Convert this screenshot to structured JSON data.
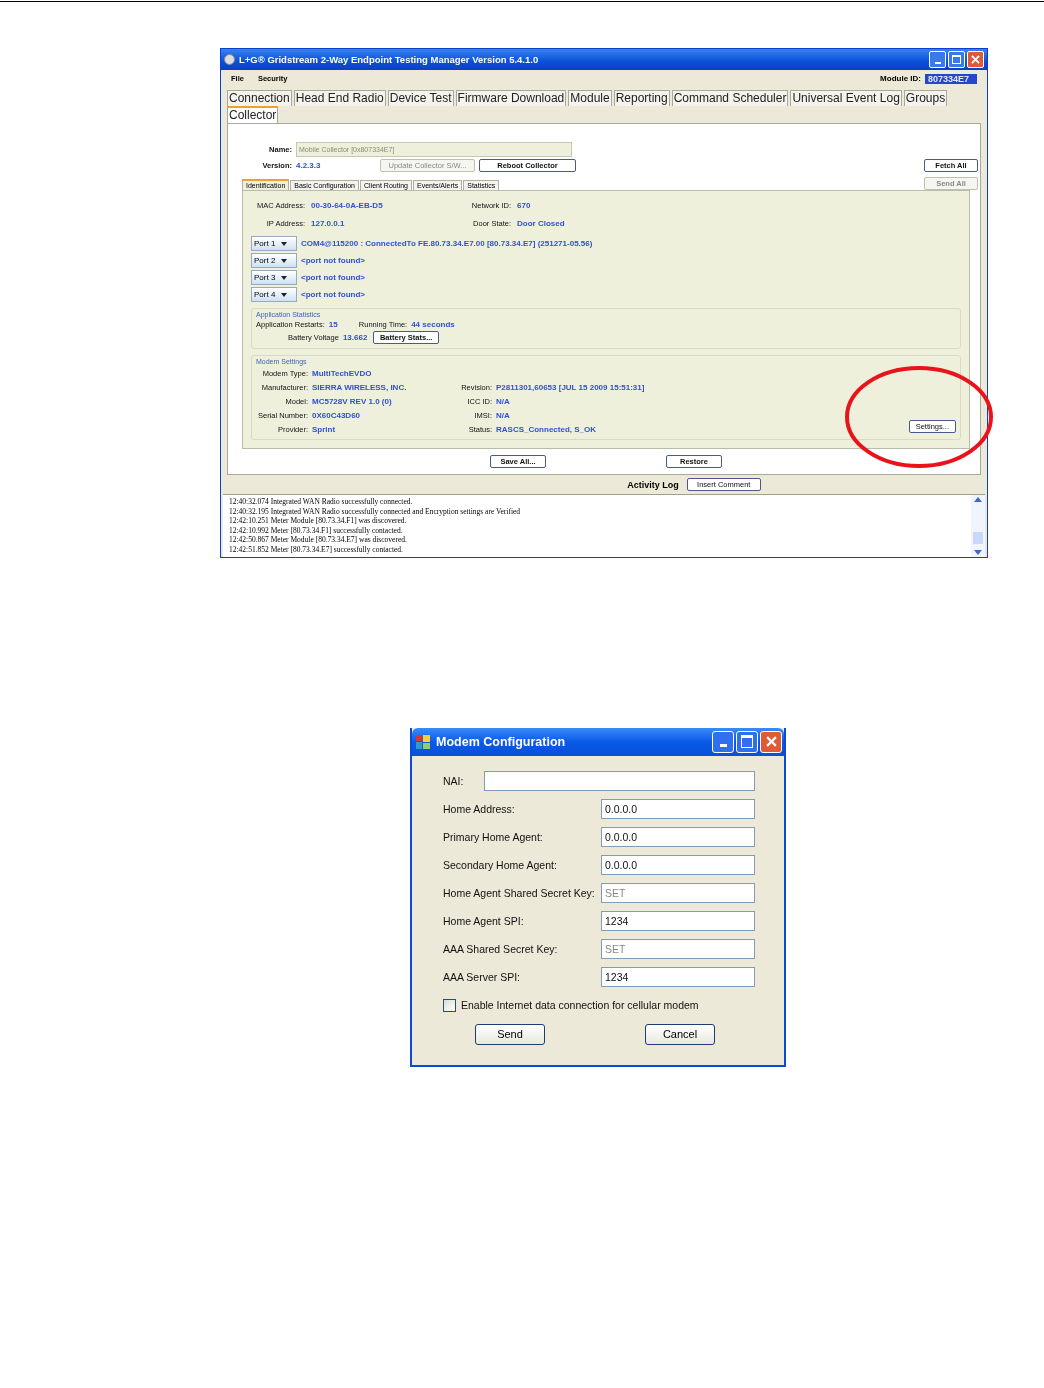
{
  "main_window": {
    "title": "L+G® Gridstream 2-Way Endpoint Testing Manager Version 5.4.1.0",
    "menu": [
      "File",
      "Security"
    ],
    "module_id_label": "Module ID:",
    "module_id": "807334E7",
    "tab_rows": [
      [
        {
          "label": "Connection",
          "selected": false
        },
        {
          "label": "Head End Radio",
          "selected": false
        },
        {
          "label": "Device Test",
          "selected": false
        },
        {
          "label": "Firmware Download",
          "selected": false
        },
        {
          "label": "Module",
          "selected": false
        },
        {
          "label": "Reporting",
          "selected": false
        },
        {
          "label": "Command Scheduler",
          "selected": false
        },
        {
          "label": "Universal Event Log",
          "selected": false
        },
        {
          "label": "Groups",
          "selected": false
        }
      ],
      [
        {
          "label": "Collector",
          "selected": true
        }
      ]
    ],
    "name_label": "Name:",
    "name_value": "Mobile Collector [0x807334E7]",
    "version_label": "Version:",
    "version": "4.2.3.3",
    "update_button": {
      "label": "Update Collector S/W...",
      "disabled": true
    },
    "reboot_button": "Reboot Collector",
    "fetch_all": "Fetch All",
    "send_all": {
      "label": "Send All",
      "disabled": true
    },
    "subtabs": [
      {
        "label": "Identification",
        "selected": true
      },
      {
        "label": "Basic Configuration",
        "selected": false
      },
      {
        "label": "Client Routing",
        "selected": false
      },
      {
        "label": "Events/Alerts",
        "selected": false
      },
      {
        "label": "Statistics",
        "selected": false
      }
    ],
    "identity": [
      [
        {
          "label": "MAC Address:",
          "value": "00-30-64-0A-EB-D5"
        },
        {
          "label": "Network ID:",
          "value": "670"
        }
      ],
      [
        {
          "label": "IP Address:",
          "value": "127.0.0.1"
        },
        {
          "label": "Door State:",
          "value": "Door Closed"
        }
      ]
    ],
    "ports": [
      {
        "label": "Port 1",
        "status": "COM4@115200 : ConnectedTo FE.80.73.34.E7.00 [80.73.34.E7]  (251271-05.56)"
      },
      {
        "label": "Port 2",
        "status": "<port not found>"
      },
      {
        "label": "Port 3",
        "status": "<port not found>"
      },
      {
        "label": "Port 4",
        "status": "<port not found>"
      }
    ],
    "app_stats": {
      "title": "Application Statistics",
      "restarts_label": "Application Restarts:",
      "restarts": "15",
      "running_label": "Running Time:",
      "running": "44 seconds",
      "battery_label": "Battery Voltage",
      "battery": "13.662",
      "battery_button": "Battery Stats..."
    },
    "modem_settings": {
      "title": "Modem Settings",
      "left": [
        {
          "label": "Modem Type:",
          "value": "MultiTechEVDO"
        },
        {
          "label": "Manufacturer:",
          "value": "SIERRA WIRELESS, INC."
        },
        {
          "label": "Model:",
          "value": "MC5728V REV 1.0 (0)"
        },
        {
          "label": "Serial Number:",
          "value": "0X60C43D60"
        },
        {
          "label": "Provider:",
          "value": "Sprint"
        }
      ],
      "right": [
        {
          "label": "Revision:",
          "value": "P2811301,60653 [JUL 15 2009 15:51:31]"
        },
        {
          "label": "ICC ID:",
          "value": "N/A"
        },
        {
          "label": "IMSI:",
          "value": "N/A"
        },
        {
          "label": "Status:",
          "value": "RASCS_Connected, S_OK"
        }
      ],
      "settings_button": "Settings..."
    },
    "save_all": "Save All...",
    "restore": "Restore",
    "activity_log": {
      "title": "Activity Log",
      "insert_button": "Insert Comment",
      "lines": [
        "12:40:32.074 Integrated WAN Radio successfully connected.",
        "12:40:32.195 Integrated WAN Radio successfully connected and Encryption settings are Verified",
        "12:42:10.251 Meter Module [80.73.34.F1] was discovered.",
        "12:42:10.992 Meter [80.73.34.F1] successfully contacted.",
        "12:42:50.867 Meter Module [80.73.34.E7] was discovered.",
        "12:42:51.852 Meter [80.73.34.E7] successfully contacted."
      ]
    }
  },
  "dialog": {
    "title": "Modem Configuration",
    "fields": [
      {
        "label": "NAI:",
        "disabled": false,
        "wide": true
      },
      {
        "label": "Home Address:",
        "value": "0.0.0.0",
        "disabled": false,
        "wide": false
      },
      {
        "label": "Primary Home Agent:",
        "value": "0.0.0.0",
        "disabled": false,
        "wide": false
      },
      {
        "label": "Secondary Home Agent:",
        "value": "0.0.0.0",
        "disabled": false,
        "wide": false
      },
      {
        "label": "Home Agent Shared Secret Key:",
        "value": "SET",
        "disabled": true,
        "wide": false
      },
      {
        "label": "Home Agent SPI:",
        "value": "1234",
        "disabled": false,
        "wide": false
      },
      {
        "label": "AAA Shared Secret Key:",
        "value": "SET",
        "disabled": true,
        "wide": false
      },
      {
        "label": "AAA Server SPI:",
        "value": "1234",
        "disabled": false,
        "wide": false
      }
    ],
    "checkbox": {
      "label": "Enable Internet data connection for cellular modem",
      "checked": false
    },
    "buttons": [
      "Send",
      "Cancel"
    ]
  }
}
